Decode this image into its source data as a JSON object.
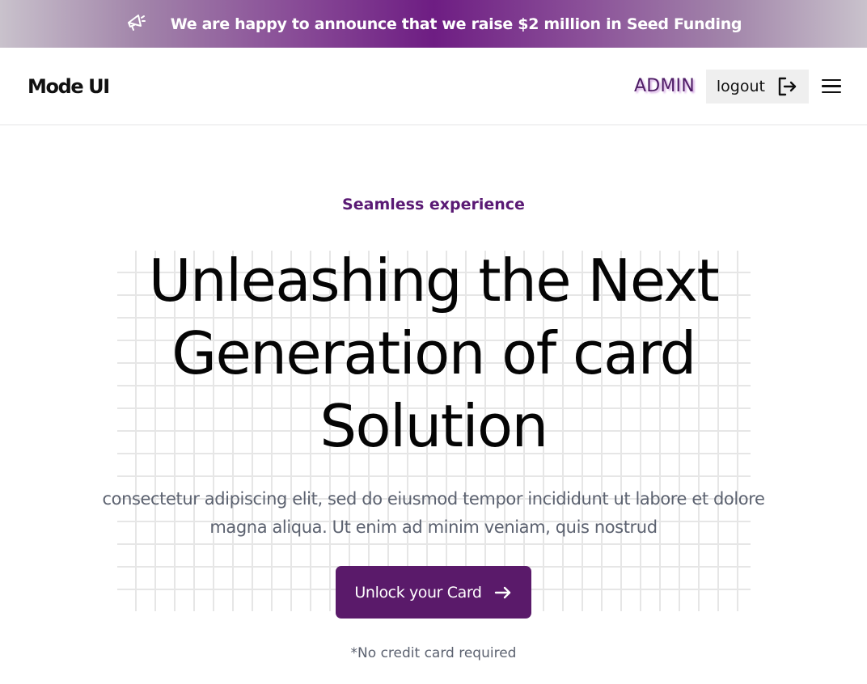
{
  "announcement": {
    "icon": "megaphone-icon",
    "text": "We are happy to announce that we raise $2 million in Seed Funding"
  },
  "header": {
    "logo": "Mode UI",
    "admin_label": "ADMIN",
    "logout_label": "logout",
    "logout_icon": "logout-icon",
    "menu_icon": "hamburger-menu-icon"
  },
  "hero": {
    "eyebrow": "Seamless experience",
    "headline": "Unleashing the Next Generation of card Solution",
    "subtext": "consectetur adipiscing elit, sed do eiusmod tempor incididunt ut labore et dolore magna aliqua. Ut enim ad minim veniam, quis nostrud",
    "cta_label": "Unlock your Card",
    "cta_icon": "arrow-right-icon",
    "note": "*No credit card required"
  },
  "colors": {
    "brand_purple": "#5a1a6a",
    "announcement_center": "#6e1d83",
    "eyebrow": "#5a1a74",
    "body_text": "#5c6270"
  }
}
